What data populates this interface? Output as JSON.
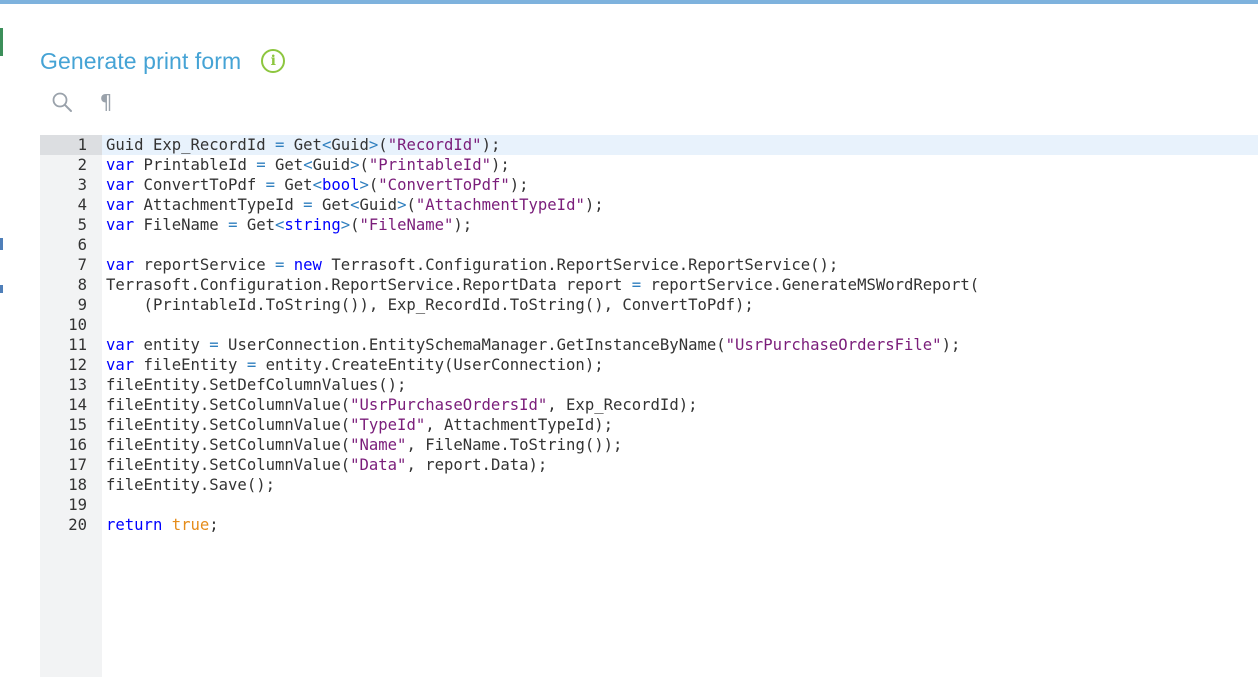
{
  "page": {
    "title": "Generate print form",
    "info_icon": "info-icon",
    "accent_color": "#45a3d5",
    "info_color": "#8dc63f"
  },
  "toolbar": {
    "search_icon": "search-icon",
    "formatting_icon": "pilcrow-icon",
    "formatting_glyph": "¶"
  },
  "editor": {
    "language": "csharp",
    "active_line": 1,
    "lines": [
      [
        [
          "",
          "Guid Exp_RecordId "
        ],
        [
          "op",
          "="
        ],
        [
          "",
          " Get"
        ],
        [
          "op",
          "<"
        ],
        [
          "",
          "Guid"
        ],
        [
          "op",
          ">"
        ],
        [
          "",
          "("
        ],
        [
          "str",
          "\"RecordId\""
        ],
        [
          "",
          ");"
        ]
      ],
      [
        [
          "kw",
          "var"
        ],
        [
          "",
          " PrintableId "
        ],
        [
          "op",
          "="
        ],
        [
          "",
          " Get"
        ],
        [
          "op",
          "<"
        ],
        [
          "",
          "Guid"
        ],
        [
          "op",
          ">"
        ],
        [
          "",
          "("
        ],
        [
          "str",
          "\"PrintableId\""
        ],
        [
          "",
          ");"
        ]
      ],
      [
        [
          "kw",
          "var"
        ],
        [
          "",
          " ConvertToPdf "
        ],
        [
          "op",
          "="
        ],
        [
          "",
          " Get"
        ],
        [
          "op",
          "<"
        ],
        [
          "kw",
          "bool"
        ],
        [
          "op",
          ">"
        ],
        [
          "",
          "("
        ],
        [
          "str",
          "\"ConvertToPdf\""
        ],
        [
          "",
          ");"
        ]
      ],
      [
        [
          "kw",
          "var"
        ],
        [
          "",
          " AttachmentTypeId "
        ],
        [
          "op",
          "="
        ],
        [
          "",
          " Get"
        ],
        [
          "op",
          "<"
        ],
        [
          "",
          "Guid"
        ],
        [
          "op",
          ">"
        ],
        [
          "",
          "("
        ],
        [
          "str",
          "\"AttachmentTypeId\""
        ],
        [
          "",
          ");"
        ]
      ],
      [
        [
          "kw",
          "var"
        ],
        [
          "",
          " FileName "
        ],
        [
          "op",
          "="
        ],
        [
          "",
          " Get"
        ],
        [
          "op",
          "<"
        ],
        [
          "kw",
          "string"
        ],
        [
          "op",
          ">"
        ],
        [
          "",
          "("
        ],
        [
          "str",
          "\"FileName\""
        ],
        [
          "",
          ");"
        ]
      ],
      [],
      [
        [
          "kw",
          "var"
        ],
        [
          "",
          " reportService "
        ],
        [
          "op",
          "="
        ],
        [
          "",
          " "
        ],
        [
          "kw",
          "new"
        ],
        [
          "",
          " Terrasoft.Configuration.ReportService.ReportService();"
        ]
      ],
      [
        [
          "",
          "Terrasoft.Configuration.ReportService.ReportData report "
        ],
        [
          "op",
          "="
        ],
        [
          "",
          " reportService.GenerateMSWordReport("
        ]
      ],
      [
        [
          "",
          "    (PrintableId.ToString()), Exp_RecordId.ToString(), ConvertToPdf);"
        ]
      ],
      [],
      [
        [
          "kw",
          "var"
        ],
        [
          "",
          " entity "
        ],
        [
          "op",
          "="
        ],
        [
          "",
          " UserConnection.EntitySchemaManager.GetInstanceByName("
        ],
        [
          "str",
          "\"UsrPurchaseOrdersFile\""
        ],
        [
          "",
          ");"
        ]
      ],
      [
        [
          "kw",
          "var"
        ],
        [
          "",
          " fileEntity "
        ],
        [
          "op",
          "="
        ],
        [
          "",
          " entity.CreateEntity(UserConnection);"
        ]
      ],
      [
        [
          "",
          "fileEntity.SetDefColumnValues();"
        ]
      ],
      [
        [
          "",
          "fileEntity.SetColumnValue("
        ],
        [
          "str",
          "\"UsrPurchaseOrdersId\""
        ],
        [
          "",
          ", Exp_RecordId);"
        ]
      ],
      [
        [
          "",
          "fileEntity.SetColumnValue("
        ],
        [
          "str",
          "\"TypeId\""
        ],
        [
          "",
          ", AttachmentTypeId);"
        ]
      ],
      [
        [
          "",
          "fileEntity.SetColumnValue("
        ],
        [
          "str",
          "\"Name\""
        ],
        [
          "",
          ", FileName.ToString());"
        ]
      ],
      [
        [
          "",
          "fileEntity.SetColumnValue("
        ],
        [
          "str",
          "\"Data\""
        ],
        [
          "",
          ", report.Data);"
        ]
      ],
      [
        [
          "",
          "fileEntity.Save();"
        ]
      ],
      [],
      [
        [
          "kw",
          "return"
        ],
        [
          "",
          " "
        ],
        [
          "lit",
          "true"
        ],
        [
          "",
          ";"
        ]
      ]
    ]
  }
}
